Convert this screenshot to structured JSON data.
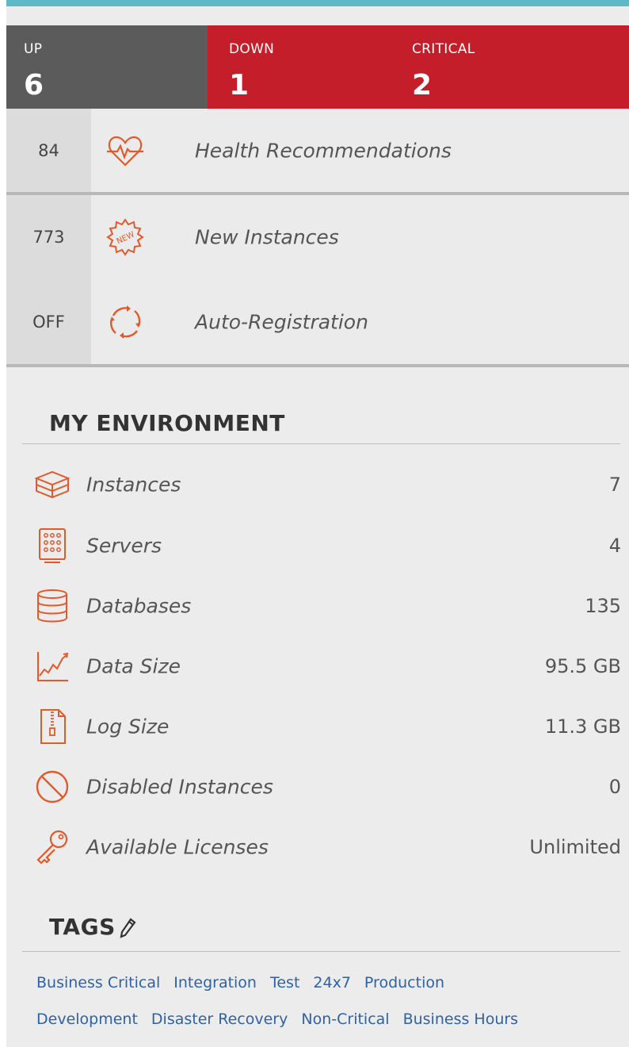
{
  "status": {
    "up": {
      "label": "UP",
      "value": "6"
    },
    "down": {
      "label": "DOWN",
      "value": "1"
    },
    "critical": {
      "label": "CRITICAL",
      "value": "2"
    }
  },
  "summary": [
    {
      "count": "84",
      "label": "Health Recommendations",
      "icon": "heart-pulse-icon"
    },
    {
      "count": "773",
      "label": "New Instances",
      "icon": "new-badge-icon"
    },
    {
      "count": "OFF",
      "label": "Auto-Registration",
      "icon": "refresh-cycle-icon"
    }
  ],
  "environment": {
    "title": "MY ENVIRONMENT",
    "items": [
      {
        "label": "Instances",
        "value": "7",
        "icon": "instances-icon"
      },
      {
        "label": "Servers",
        "value": "4",
        "icon": "server-icon"
      },
      {
        "label": "Databases",
        "value": "135",
        "icon": "database-icon"
      },
      {
        "label": "Data Size",
        "value": "95.5 GB",
        "icon": "line-chart-icon"
      },
      {
        "label": "Log Size",
        "value": "11.3 GB",
        "icon": "zip-file-icon"
      },
      {
        "label": "Disabled Instances",
        "value": "0",
        "icon": "disabled-icon"
      },
      {
        "label": "Available Licenses",
        "value": "Unlimited",
        "icon": "key-icon"
      }
    ]
  },
  "tags": {
    "title": "TAGS",
    "rows": [
      [
        "Business Critical",
        "Integration",
        "Test",
        "24x7",
        "Production"
      ],
      [
        "Development",
        "Disaster Recovery",
        "Non-Critical",
        "Business Hours"
      ]
    ]
  },
  "colors": {
    "accent": "#e05a2b",
    "critical": "#c41e2a",
    "up": "#5b5b5b",
    "link": "#2f62a4",
    "topline": "#5db8c7"
  }
}
